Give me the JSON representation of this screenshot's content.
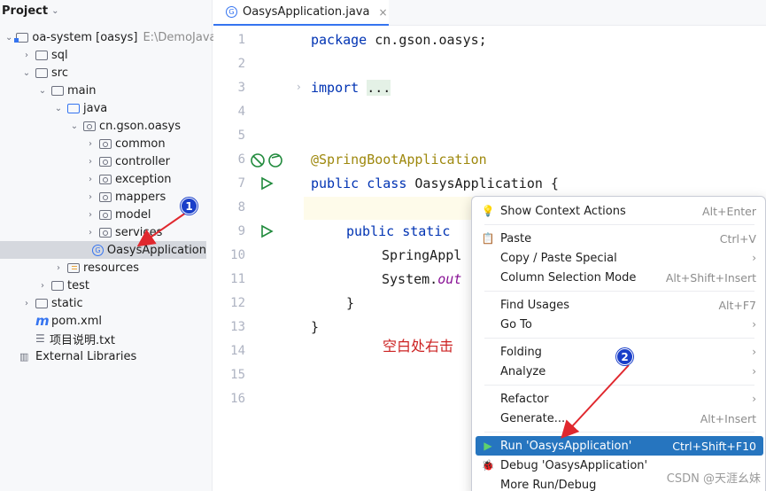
{
  "project": {
    "header": "Project",
    "tree": [
      {
        "label": "oa-system [oasys]",
        "hint": "E:\\DemoJava\\c",
        "depth": 0,
        "arrow": "⌄",
        "icon": "module"
      },
      {
        "label": "sql",
        "depth": 1,
        "arrow": "›",
        "icon": "folder"
      },
      {
        "label": "src",
        "depth": 1,
        "arrow": "⌄",
        "icon": "folder"
      },
      {
        "label": "main",
        "depth": 2,
        "arrow": "⌄",
        "icon": "folder"
      },
      {
        "label": "java",
        "depth": 3,
        "arrow": "⌄",
        "icon": "src"
      },
      {
        "label": "cn.gson.oasys",
        "depth": 4,
        "arrow": "⌄",
        "icon": "pkg"
      },
      {
        "label": "common",
        "depth": 5,
        "arrow": "›",
        "icon": "pkg"
      },
      {
        "label": "controller",
        "depth": 5,
        "arrow": "›",
        "icon": "pkg"
      },
      {
        "label": "exception",
        "depth": 5,
        "arrow": "›",
        "icon": "pkg"
      },
      {
        "label": "mappers",
        "depth": 5,
        "arrow": "›",
        "icon": "pkg"
      },
      {
        "label": "model",
        "depth": 5,
        "arrow": "›",
        "icon": "pkg"
      },
      {
        "label": "services",
        "depth": 5,
        "arrow": "›",
        "icon": "pkg"
      },
      {
        "label": "OasysApplication",
        "depth": 5,
        "arrow": "",
        "icon": "class",
        "selected": true
      },
      {
        "label": "resources",
        "depth": 3,
        "arrow": "›",
        "icon": "res"
      },
      {
        "label": "test",
        "depth": 2,
        "arrow": "›",
        "icon": "folder"
      },
      {
        "label": "static",
        "depth": 1,
        "arrow": "›",
        "icon": "folder"
      },
      {
        "label": "pom.xml",
        "depth": 1,
        "arrow": "",
        "icon": "maven"
      },
      {
        "label": "项目说明.txt",
        "depth": 1,
        "arrow": "",
        "icon": "text"
      },
      {
        "label": "External Libraries",
        "depth": 0,
        "arrow": "",
        "icon": "library"
      }
    ]
  },
  "editor": {
    "tab_label": "OasysApplication.java",
    "tab_close": "×",
    "line_numbers": [
      "1",
      "2",
      "3",
      "4",
      "5",
      "6",
      "7",
      "8",
      "9",
      "10",
      "11",
      "12",
      "13",
      "14",
      "15",
      "16"
    ],
    "code": {
      "l1_kw": "package",
      "l1_rest": " cn.gson.oasys;",
      "l3_kw": "import",
      "l3_rest": " ",
      "l3_collapsed": "...",
      "l7_ann": "@SpringBootApplication",
      "l8_kw": "public class",
      "l8_rest": " OasysApplication {",
      "l10_kw": "public static",
      "l11": "SpringAppl",
      "l12_a": "System.",
      "l12_b": "out",
      "l13": "}",
      "l14": "}"
    },
    "annotation_text": "空白处右击"
  },
  "context_menu": {
    "items": [
      {
        "icon": "lightbulb-icon",
        "glyph": "💡",
        "label": "Show Context Actions",
        "shortcut": "Alt+Enter"
      },
      {
        "icon": "paste-icon",
        "glyph": "📋",
        "label": "Paste",
        "shortcut": "Ctrl+V"
      },
      {
        "icon": "",
        "glyph": "",
        "label": "Copy / Paste Special",
        "submenu": "›"
      },
      {
        "icon": "",
        "glyph": "",
        "label": "Column Selection Mode",
        "shortcut": "Alt+Shift+Insert"
      },
      {
        "icon": "",
        "glyph": "",
        "label": "Find Usages",
        "shortcut": "Alt+F7"
      },
      {
        "icon": "",
        "glyph": "",
        "label": "Go To",
        "submenu": "›"
      },
      {
        "icon": "",
        "glyph": "",
        "label": "Folding",
        "submenu": "›"
      },
      {
        "icon": "",
        "glyph": "",
        "label": "Analyze",
        "submenu": "›"
      },
      {
        "icon": "",
        "glyph": "",
        "label": "Refactor",
        "submenu": "›"
      },
      {
        "icon": "",
        "glyph": "",
        "label": "Generate...",
        "shortcut": "Alt+Insert"
      },
      {
        "icon": "run-icon",
        "glyph": "▶",
        "label": "Run 'OasysApplication'",
        "shortcut": "Ctrl+Shift+F10",
        "active": true
      },
      {
        "icon": "debug-icon",
        "glyph": "🐞",
        "label": "Debug 'OasysApplication'",
        "shortcut": ""
      },
      {
        "icon": "",
        "glyph": "",
        "label": "More Run/Debug",
        "submenu": ""
      }
    ]
  },
  "badges": {
    "one": "1",
    "two": "2"
  },
  "colors": {
    "accent": "#2675bf",
    "badge": "#1a3fc9",
    "arrow": "#e0282e",
    "annotation": "#cc2222"
  },
  "watermark": "CSDN @天涯幺妹"
}
